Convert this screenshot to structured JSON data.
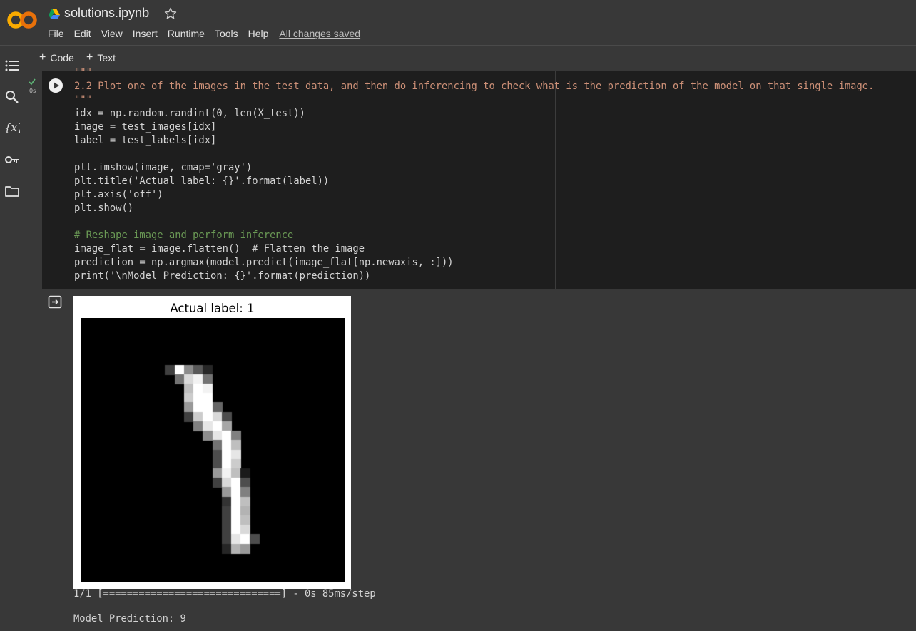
{
  "header": {
    "file_name": "solutions.ipynb",
    "logo_text": "CO",
    "menu": [
      "File",
      "Edit",
      "View",
      "Insert",
      "Runtime",
      "Tools",
      "Help"
    ],
    "save_status": "All changes saved"
  },
  "toolbar": {
    "add_code_label": "Code",
    "add_text_label": "Text"
  },
  "sidebar": {
    "icons": [
      "table-of-contents-icon",
      "search-icon",
      "variables-icon",
      "secrets-key-icon",
      "files-folder-icon"
    ]
  },
  "cell": {
    "exec_time": "0s",
    "code_lines": [
      "\"\"\"",
      "2.2 Plot one of the images in the test data, and then do inferencing to check what is the prediction of the model on that single image.",
      "\"\"\"",
      "idx = np.random.randint(0, len(X_test))",
      "image = test_images[idx]",
      "label = test_labels[idx]",
      "",
      "plt.imshow(image, cmap='gray')",
      "plt.title('Actual label: {}'.format(label))",
      "plt.axis('off')",
      "plt.show()",
      "",
      "# Reshape image and perform inference",
      "image_flat = image.flatten()  # Flatten the image",
      "prediction = np.argmax(model.predict(image_flat[np.newaxis, :]))",
      "print('\\nModel Prediction: {}'.format(prediction))"
    ]
  },
  "output": {
    "figure_title": "Actual label: 1",
    "progress_line": "1/1 [==============================] - 0s 85ms/step",
    "prediction_line": "Model Prediction: 9",
    "digit": {
      "grid_size": 28,
      "pixels": [
        [
          5,
          9,
          0.25
        ],
        [
          5,
          10,
          1.0
        ],
        [
          5,
          11,
          0.55
        ],
        [
          5,
          12,
          0.35
        ],
        [
          5,
          13,
          0.15
        ],
        [
          6,
          10,
          0.45
        ],
        [
          6,
          11,
          0.85
        ],
        [
          6,
          12,
          0.95
        ],
        [
          6,
          13,
          0.45
        ],
        [
          7,
          11,
          0.75
        ],
        [
          7,
          12,
          1.0
        ],
        [
          7,
          13,
          0.95
        ],
        [
          8,
          11,
          0.8
        ],
        [
          8,
          12,
          1.0
        ],
        [
          8,
          13,
          1.0
        ],
        [
          9,
          11,
          0.6
        ],
        [
          9,
          12,
          1.0
        ],
        [
          9,
          13,
          1.0
        ],
        [
          9,
          14,
          0.4
        ],
        [
          10,
          11,
          0.25
        ],
        [
          10,
          12,
          0.8
        ],
        [
          10,
          13,
          1.0
        ],
        [
          10,
          14,
          0.85
        ],
        [
          10,
          15,
          0.3
        ],
        [
          11,
          12,
          0.5
        ],
        [
          11,
          13,
          0.9
        ],
        [
          11,
          14,
          1.0
        ],
        [
          11,
          15,
          0.65
        ],
        [
          12,
          13,
          0.55
        ],
        [
          12,
          14,
          0.9
        ],
        [
          12,
          15,
          1.0
        ],
        [
          12,
          16,
          0.5
        ],
        [
          13,
          14,
          0.45
        ],
        [
          13,
          15,
          1.0
        ],
        [
          13,
          16,
          0.75
        ],
        [
          14,
          14,
          0.3
        ],
        [
          14,
          15,
          1.0
        ],
        [
          14,
          16,
          0.9
        ],
        [
          15,
          14,
          0.3
        ],
        [
          15,
          15,
          1.0
        ],
        [
          15,
          16,
          0.8
        ],
        [
          16,
          14,
          0.6
        ],
        [
          16,
          15,
          0.95
        ],
        [
          16,
          16,
          0.75
        ],
        [
          16,
          17,
          0.1
        ],
        [
          17,
          14,
          0.25
        ],
        [
          17,
          15,
          0.85
        ],
        [
          17,
          16,
          1.0
        ],
        [
          17,
          17,
          0.3
        ],
        [
          18,
          15,
          0.6
        ],
        [
          18,
          16,
          1.0
        ],
        [
          18,
          17,
          0.5
        ],
        [
          19,
          15,
          0.2
        ],
        [
          19,
          16,
          1.0
        ],
        [
          19,
          17,
          0.75
        ],
        [
          20,
          15,
          0.25
        ],
        [
          20,
          16,
          1.0
        ],
        [
          20,
          17,
          0.7
        ],
        [
          21,
          15,
          0.25
        ],
        [
          21,
          16,
          1.0
        ],
        [
          21,
          17,
          0.75
        ],
        [
          22,
          15,
          0.25
        ],
        [
          22,
          16,
          1.0
        ],
        [
          22,
          17,
          0.85
        ],
        [
          23,
          15,
          0.25
        ],
        [
          23,
          16,
          0.9
        ],
        [
          23,
          17,
          1.0
        ],
        [
          23,
          18,
          0.3
        ],
        [
          24,
          15,
          0.15
        ],
        [
          24,
          16,
          0.7
        ],
        [
          24,
          17,
          0.6
        ]
      ]
    }
  }
}
